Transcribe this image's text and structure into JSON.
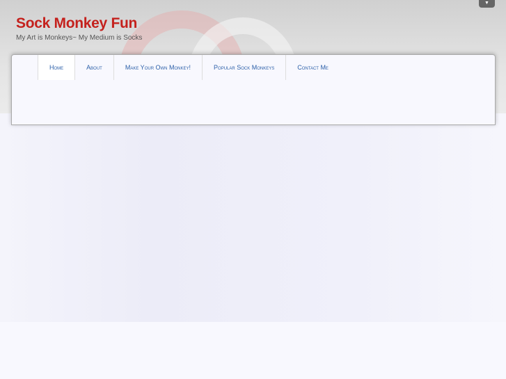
{
  "site": {
    "title": "Sock Monkey Fun",
    "tagline": "My Art is Monkeys~ My Medium is Socks"
  },
  "nav": [
    {
      "label": "Home"
    },
    {
      "label": "About"
    },
    {
      "label": "Make Your Own Monkey!"
    },
    {
      "label": "Popular Sock Monkeys"
    },
    {
      "label": "Contact Me"
    }
  ],
  "toggle_icon": "chevron-down-icon"
}
